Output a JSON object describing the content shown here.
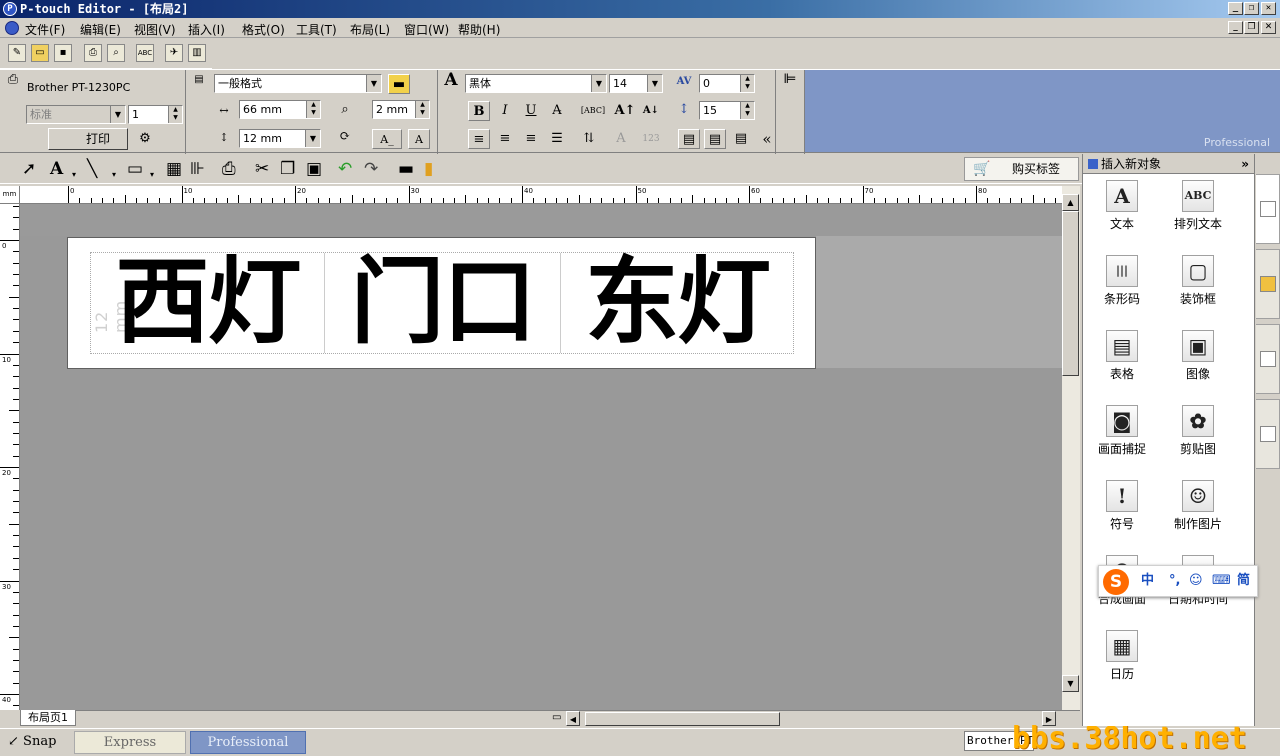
{
  "window": {
    "title": "P-touch Editor - [布局2]"
  },
  "menu": [
    "文件(F)",
    "编辑(E)",
    "视图(V)",
    "插入(I)",
    "格式(O)",
    "工具(T)",
    "布局(L)",
    "窗口(W)",
    "帮助(H)"
  ],
  "printer": {
    "name": "Brother PT-1230PC",
    "quality": "标准",
    "copies": "1",
    "print_label": "打印"
  },
  "format": {
    "style": "一般格式",
    "length": "66 mm",
    "margin": "2 mm",
    "tape_width": "12 mm",
    "format_text": "A"
  },
  "font": {
    "face": "黑体",
    "size": "14",
    "char_spacing": "0",
    "line_spacing": "15",
    "bold": "B",
    "italic": "I",
    "underline": "U",
    "expand": "«"
  },
  "blue_panel": {
    "edition": "Professional"
  },
  "draw_toolbar": {
    "buy_label": "购买标签"
  },
  "ruler": {
    "unit": "mm",
    "h_labels": [
      "0",
      "10",
      "20",
      "30",
      "40",
      "50",
      "60",
      "70",
      "80"
    ],
    "v_labels": [
      "0",
      "10",
      "20",
      "30",
      "40"
    ]
  },
  "label": {
    "tape_caption": "12 mm",
    "cells": [
      "西灯",
      "门口",
      "东灯"
    ]
  },
  "page_tab": "布局页1",
  "modes": {
    "snap": "Snap",
    "express": "Express",
    "professional": "Professional"
  },
  "status": {
    "printer": "Brother PT-1230PC"
  },
  "watermark": "bbs.38hot.net",
  "side_panel": {
    "title": "插入新对象",
    "objects": [
      {
        "label": "文本",
        "icon": "A"
      },
      {
        "label": "排列文本",
        "icon": "ABC"
      },
      {
        "label": "条形码",
        "icon": "|||"
      },
      {
        "label": "装饰框",
        "icon": "▢"
      },
      {
        "label": "表格",
        "icon": "▤"
      },
      {
        "label": "图像",
        "icon": "▣"
      },
      {
        "label": "画面捕捉",
        "icon": "◙"
      },
      {
        "label": "剪贴图",
        "icon": "✿"
      },
      {
        "label": "符号",
        "icon": "!"
      },
      {
        "label": "制作图片",
        "icon": "☺"
      },
      {
        "label": "合成画面",
        "icon": "☻"
      },
      {
        "label": "日期和时间",
        "icon": "◷"
      },
      {
        "label": "日历",
        "icon": "▦"
      }
    ]
  },
  "ime": {
    "logo": "S",
    "lang": "中",
    "punct": "°,",
    "emoji": "☺",
    "keyboard": "⌨",
    "mode": "简"
  },
  "colors": {
    "title_start": "#0a246a",
    "canvas": "#999999",
    "blue_panel": "#7f96c6",
    "watermark": "#ffb000"
  }
}
